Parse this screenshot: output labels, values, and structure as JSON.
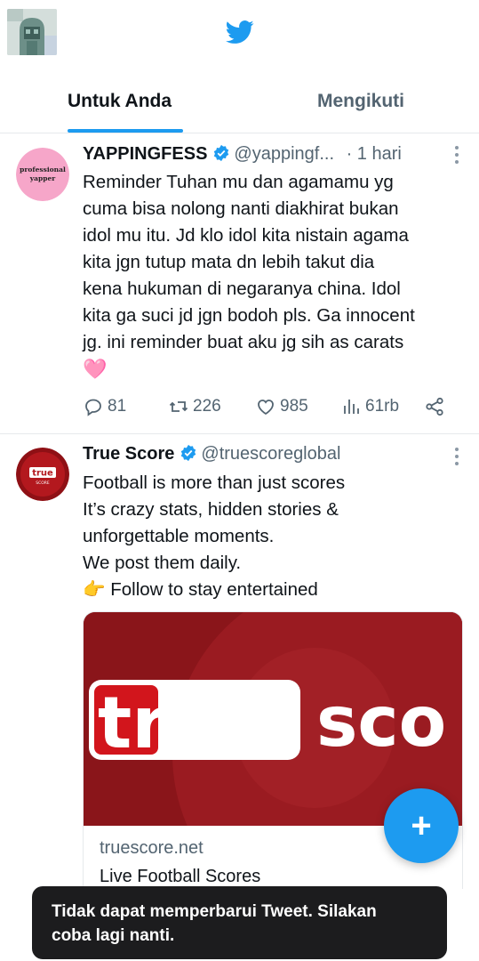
{
  "header": {
    "logo_icon": "twitter-bird-icon",
    "brand_color": "#1d9bf0",
    "profile_avatar": "profile-avatar"
  },
  "tabs": [
    {
      "label": "Untuk Anda",
      "active": true
    },
    {
      "label": "Mengikuti",
      "active": false
    }
  ],
  "tweets": [
    {
      "avatar_text": [
        "professional",
        "yapper"
      ],
      "name": "YAPPINGFESS",
      "handle": "@yappingf...",
      "time": "· 1 hari",
      "text_lines": [
        "Reminder Tuhan mu dan agamamu yg",
        "cuma bisa nolong nanti diakhirat bukan",
        "idol mu itu. Jd klo idol kita nistain agama",
        "kita jgn tutup mata dn lebih takut dia",
        "kena hukuman di negaranya china. Idol",
        "kita ga suci jd jgn bodoh pls. Ga innocent",
        "jg. ini reminder buat aku jg sih as carats"
      ],
      "emoji": "🩷",
      "stats": {
        "replies": "81",
        "retweets": "226",
        "likes": "985",
        "views": "61rb"
      }
    },
    {
      "avatar_text": [
        "true",
        "SCORE"
      ],
      "name": "True Score",
      "handle": "@truescoreglobal",
      "text_lines": [
        "Football is more than just scores",
        "It’s crazy stats, hidden stories &",
        "unforgettable moments.",
        "We post them daily.",
        "👉 Follow to stay entertained"
      ],
      "card": {
        "logo_word_boxed": "true",
        "logo_word_rest": "sco",
        "domain": "truescore.net",
        "title": "Live Football Scores"
      }
    }
  ],
  "fab": {
    "label": "+",
    "icon": "compose-plus-icon"
  },
  "toast": {
    "line1": "Tidak dapat memperbarui Tweet. Silakan",
    "line2": "coba lagi nanti."
  }
}
